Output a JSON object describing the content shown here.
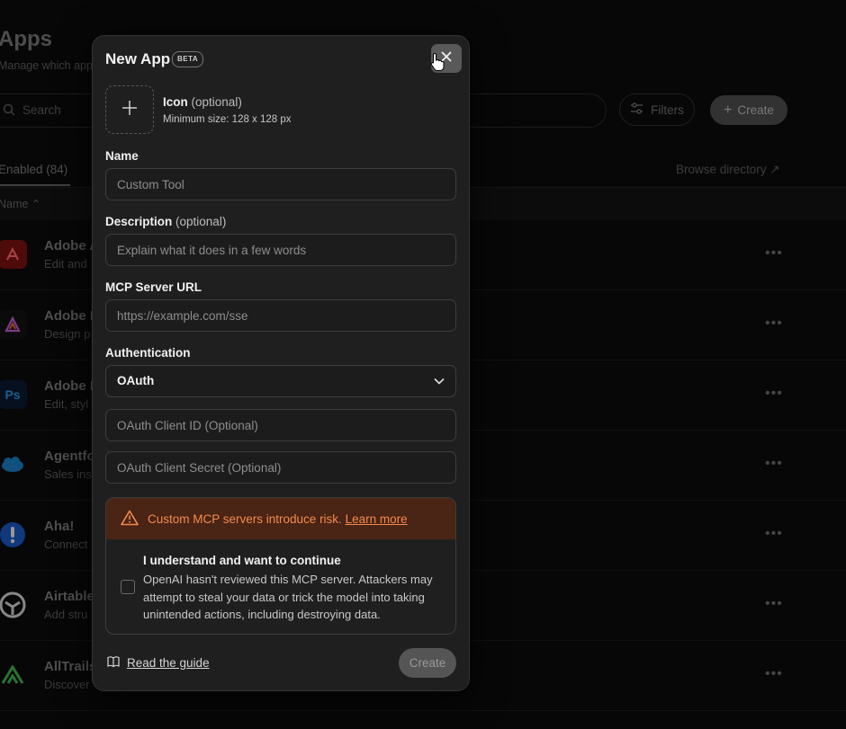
{
  "background": {
    "title": "Apps",
    "subtitle": "Manage which apps",
    "search_placeholder": "Search",
    "filters_label": "Filters",
    "create_label": "Create",
    "tab_label": "Enabled (84)",
    "browse_label": "Browse directory ↗",
    "column_header": "Name ⌃",
    "rows": [
      {
        "name": "Adobe A",
        "desc": "Edit and",
        "icon": "adobe-acrobat-icon",
        "color": "#7a1010"
      },
      {
        "name": "Adobe E",
        "desc": "Design p",
        "icon": "adobe-express-icon",
        "color": "#111111"
      },
      {
        "name": "Adobe P",
        "desc": "Edit, styl",
        "icon": "adobe-photoshop-icon",
        "color": "#0a1a2e"
      },
      {
        "name": "Agentfo",
        "desc": "Sales ins",
        "icon": "salesforce-cloud-icon",
        "color": "#0b0b0b"
      },
      {
        "name": "Aha!",
        "desc": "Connect",
        "icon": "aha-exclamation-icon",
        "color": "#0b0b0b"
      },
      {
        "name": "Airtable",
        "desc": "Add stru",
        "icon": "airtable-icon",
        "color": "#0b0b0b"
      },
      {
        "name": "AllTrails",
        "desc": "Discover",
        "icon": "alltrails-mountain-icon",
        "color": "#0b0b0b"
      }
    ]
  },
  "modal": {
    "title": "New App",
    "badge": "BETA",
    "icon_label": "Icon",
    "icon_optional": "(optional)",
    "icon_hint": "Minimum size: 128 x 128 px",
    "name_label": "Name",
    "name_placeholder": "Custom Tool",
    "description_label": "Description",
    "description_optional": "(optional)",
    "description_placeholder": "Explain what it does in a few words",
    "url_label": "MCP Server URL",
    "url_placeholder": "https://example.com/sse",
    "auth_label": "Authentication",
    "auth_value": "OAuth",
    "client_id_placeholder": "OAuth Client ID (Optional)",
    "client_secret_placeholder": "OAuth Client Secret (Optional)",
    "warning_text": "Custom MCP servers introduce risk.",
    "learn_more": "Learn more",
    "ack_title": "I understand and want to continue",
    "ack_text": "OpenAI hasn't reviewed this MCP server. Attackers may attempt to steal your data or trick the model into taking unintended actions, including destroying data.",
    "guide_label": "Read the guide",
    "create_label": "Create"
  },
  "colors": {
    "warning_bg": "#4a2414",
    "warning_text": "#f38a4f",
    "modal_bg": "#1f1f1f"
  }
}
